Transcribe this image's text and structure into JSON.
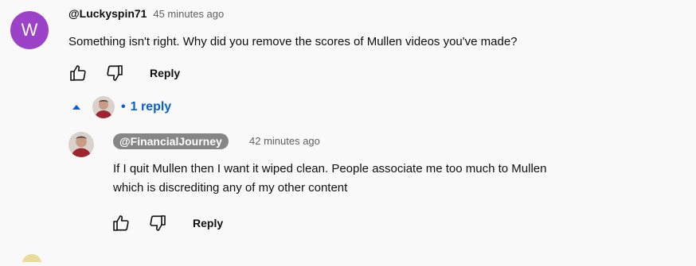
{
  "comment": {
    "avatar_letter": "W",
    "author": "@Luckyspin71",
    "time": "45 minutes ago",
    "text": "Something isn't right. Why did you remove the scores of Mullen videos you've made?",
    "reply_label": "Reply",
    "replies_toggle": "1 reply"
  },
  "reply": {
    "author": "@FinancialJourney",
    "time": "42 minutes ago",
    "text_line1": "If I quit Mullen then I want it wiped clean. People associate me too much to Mullen",
    "text_line2": "which is discrediting any of my other content",
    "reply_label": "Reply"
  },
  "colors": {
    "avatar_bg": "#9c42c8",
    "link_blue": "#065fd4",
    "chip_bg": "#868686"
  },
  "icons": [
    "thumbs-up-icon",
    "thumbs-down-icon",
    "caret-up-icon"
  ]
}
